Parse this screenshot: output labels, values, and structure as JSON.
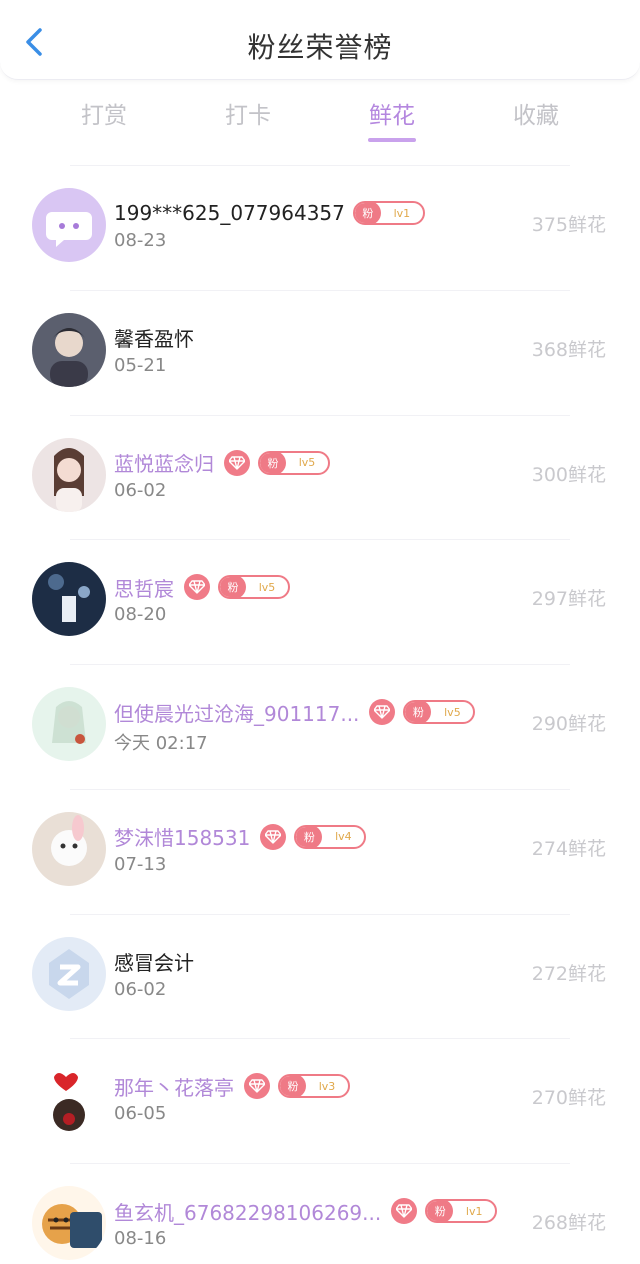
{
  "header": {
    "title": "粉丝荣誉榜"
  },
  "tabs": [
    {
      "label": "打赏"
    },
    {
      "label": "打卡"
    },
    {
      "label": "鲜花"
    },
    {
      "label": "收藏"
    }
  ],
  "active_tab": "鲜花",
  "colors": {
    "accent": "#b487df",
    "badge": "#ef7a86",
    "vip_name": "#b188d8"
  },
  "rows": [
    {
      "name": "199***625_077964357",
      "date": "08-23",
      "count": "375鲜花",
      "vip": false,
      "diamond": false,
      "fan_badge": {
        "text": "粉",
        "level": "lv1"
      }
    },
    {
      "name": "馨香盈怀",
      "date": "05-21",
      "count": "368鲜花",
      "vip": false,
      "diamond": false,
      "fan_badge": null
    },
    {
      "name": "蓝悦蓝念归",
      "date": "06-02",
      "count": "300鲜花",
      "vip": true,
      "diamond": true,
      "fan_badge": {
        "text": "粉",
        "level": "lv5"
      }
    },
    {
      "name": "思哲宸",
      "date": "08-20",
      "count": "297鲜花",
      "vip": true,
      "diamond": true,
      "fan_badge": {
        "text": "粉",
        "level": "lv5"
      }
    },
    {
      "name": "但使晨光过沧海_901117...",
      "date": "今天 02:17",
      "count": "290鲜花",
      "vip": true,
      "diamond": true,
      "fan_badge": {
        "text": "粉",
        "level": "lv5"
      }
    },
    {
      "name": "梦沫惜158531",
      "date": "07-13",
      "count": "274鲜花",
      "vip": true,
      "diamond": true,
      "fan_badge": {
        "text": "粉",
        "level": "lv4"
      }
    },
    {
      "name": "感冒会计",
      "date": "06-02",
      "count": "272鲜花",
      "vip": false,
      "diamond": false,
      "fan_badge": null
    },
    {
      "name": "那年丶花落亭",
      "date": "06-05",
      "count": "270鲜花",
      "vip": true,
      "diamond": true,
      "fan_badge": {
        "text": "粉",
        "level": "lv3"
      }
    },
    {
      "name": "鱼玄机_67682298106269...",
      "date": "08-16",
      "count": "268鲜花",
      "vip": true,
      "diamond": true,
      "fan_badge": {
        "text": "粉",
        "level": "lv1"
      }
    }
  ]
}
